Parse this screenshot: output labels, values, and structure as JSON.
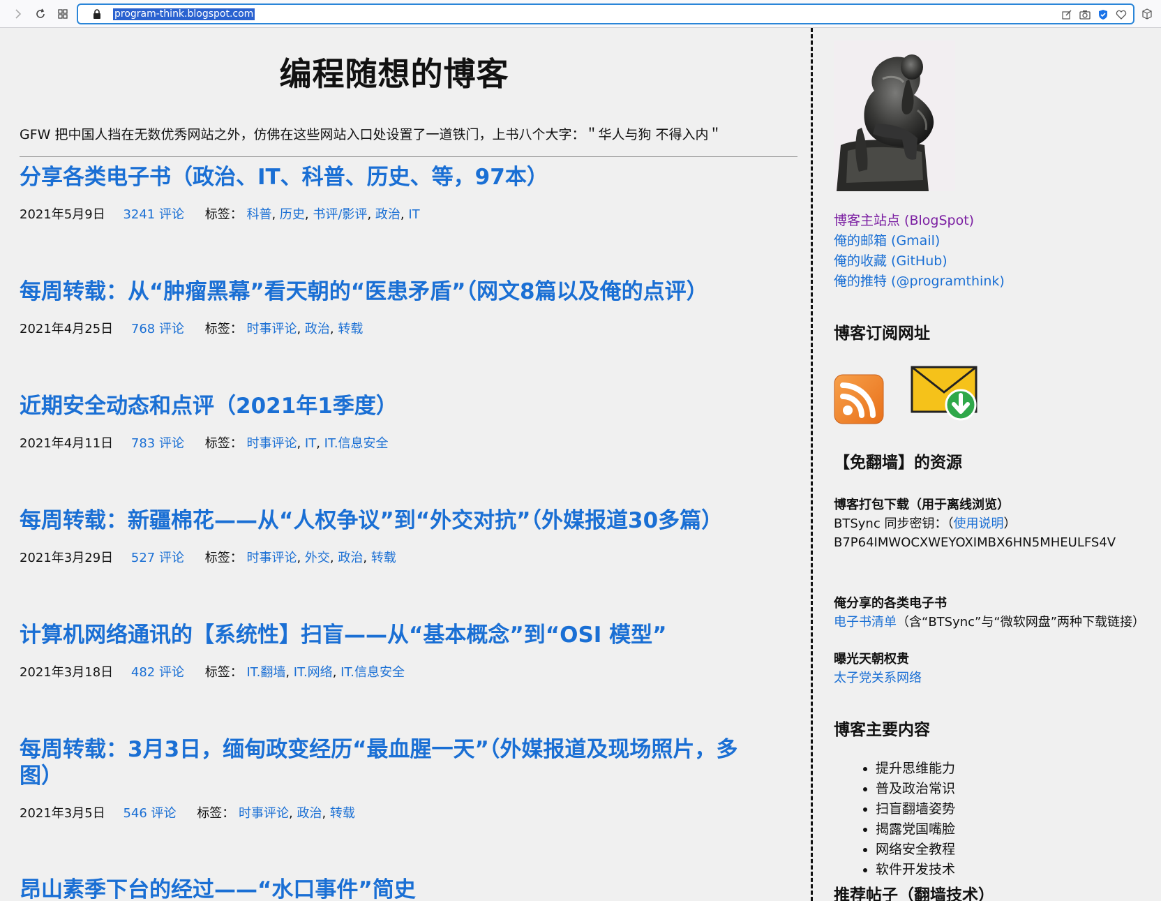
{
  "browser": {
    "url": "program-think.blogspot.com"
  },
  "blog": {
    "title": "编程随想的博客",
    "description": "GFW 把中国人挡在无数优秀网站之外，仿佛在这些网站入口处设置了一道铁门，上书八个大字：＂华人与狗 不得入内＂"
  },
  "labels_prefix": "标签：",
  "posts": [
    {
      "title": "分享各类电子书（政治、IT、科普、历史、等，97本）",
      "date": "2021年5月9日",
      "comments": "3241 评论",
      "tags": [
        "科普",
        "历史",
        "书评/影评",
        "政治",
        "IT"
      ]
    },
    {
      "title": "每周转载：从“肿瘤黑幕”看天朝的“医患矛盾”（网文8篇以及俺的点评）",
      "date": "2021年4月25日",
      "comments": "768 评论",
      "tags": [
        "时事评论",
        "政治",
        "转载"
      ]
    },
    {
      "title": "近期安全动态和点评（2021年1季度）",
      "date": "2021年4月11日",
      "comments": "783 评论",
      "tags": [
        "时事评论",
        "IT",
        "IT.信息安全"
      ]
    },
    {
      "title": "每周转载：新疆棉花——从“人权争议”到“外交对抗”（外媒报道30多篇）",
      "date": "2021年3月29日",
      "comments": "527 评论",
      "tags": [
        "时事评论",
        "外交",
        "政治",
        "转载"
      ]
    },
    {
      "title": "计算机网络通讯的【系统性】扫盲——从“基本概念”到“OSI 模型”",
      "date": "2021年3月18日",
      "comments": "482 评论",
      "tags": [
        "IT.翻墙",
        "IT.网络",
        "IT.信息安全"
      ]
    },
    {
      "title": "每周转载：3月3日，缅甸政变经历“最血腥一天”（外媒报道及现场照片，多图）",
      "date": "2021年3月5日",
      "comments": "546 评论",
      "tags": [
        "时事评论",
        "政治",
        "转载"
      ]
    },
    {
      "title": "昂山素季下台的经过——“水口事件”简史"
    }
  ],
  "sidebar": {
    "links": [
      "博客主站点 (BlogSpot)",
      "俺的邮箱 (Gmail)",
      "俺的收藏 (GitHub)",
      "俺的推特 (@programthink)"
    ],
    "subscribe_heading": "博客订阅网址",
    "resources_heading": "【免翻墙】的资源",
    "download_heading": "博客打包下载（用于离线浏览）",
    "btsync_prefix": "BTSync 同步密钥：（",
    "btsync_link": "使用说明",
    "btsync_suffix": "）",
    "btsync_key": "B7P64IMWOCXWEYOXIMBX6HN5MHEULFS4V",
    "ebooks_heading": "俺分享的各类电子书",
    "ebooks_link": "电子书清单",
    "ebooks_note": "（含“BTSync”与“微软网盘”两种下载链接）",
    "expose_heading": "曝光天朝权贵",
    "expose_link": "太子党关系网络",
    "main_content_heading": "博客主要内容",
    "main_content_items": [
      "提升思维能力",
      "普及政治常识",
      "扫盲翻墙姿势",
      "揭露党国嘴脸",
      "网络安全教程",
      "软件开发技术"
    ],
    "recommended_heading": "推荐帖子（翻墙技术）"
  }
}
